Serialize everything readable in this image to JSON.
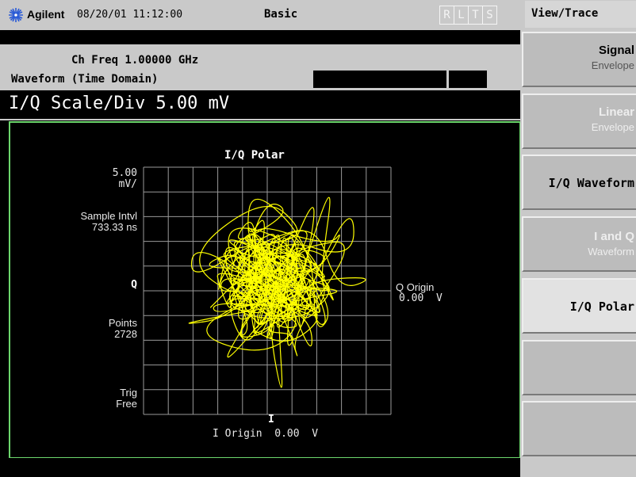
{
  "titlebar": {
    "brand": "Agilent",
    "datetime": "08/20/01 11:12:00",
    "mode": "Basic",
    "indicators": [
      "R",
      "L",
      "T",
      "S"
    ]
  },
  "header": {
    "ch_freq": "Ch Freq 1.00000 GHz",
    "waveform": "Waveform (Time Domain)",
    "scale": "I/Q Scale/Div  5.00 mV"
  },
  "plot": {
    "title": "I/Q Polar",
    "scale_value": "5.00",
    "scale_unit": "mV/",
    "sample_label": "Sample Intvl",
    "sample_value": "733.33 ns",
    "q_axis": "Q",
    "points_label": "Points",
    "points_value": "2728",
    "trig_label": "Trig",
    "trig_value": "Free",
    "q_origin_label": "Q Origin",
    "q_origin_value": "0.00  V",
    "i_axis": "I",
    "i_origin": "I Origin  0.00  V",
    "trace_color": "#ffff00",
    "grid_color": "#9a9a9a",
    "grid_divisions": 10
  },
  "softkeys": {
    "menu_title": "View/Trace",
    "keys": [
      {
        "main": "Signal",
        "sub": "Envelope",
        "enabled": false
      },
      {
        "main": "Linear",
        "sub": "Envelope",
        "enabled": false
      },
      {
        "main": "I/Q Waveform",
        "sub": "",
        "enabled": true
      },
      {
        "main": "I and Q",
        "sub": "Waveform",
        "enabled": false
      },
      {
        "main": "I/Q Polar",
        "sub": "",
        "enabled": true,
        "active": true
      },
      {
        "main": "",
        "sub": "",
        "enabled": false
      },
      {
        "main": "",
        "sub": "",
        "enabled": false
      }
    ]
  }
}
